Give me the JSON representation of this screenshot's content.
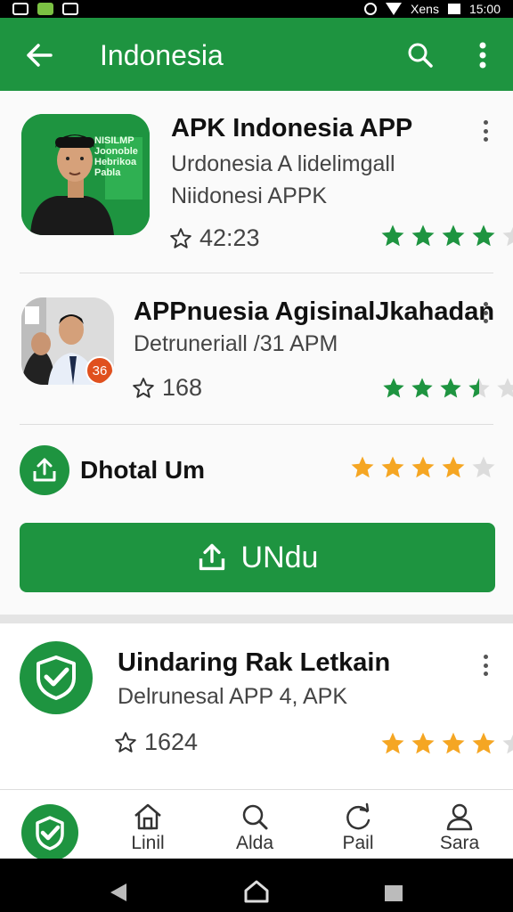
{
  "status_bar": {
    "time": "15:00",
    "carrier": "Xens"
  },
  "app_bar": {
    "title": "Indonesia",
    "back_icon": "arrow-left-icon",
    "search_icon": "search-icon",
    "more_icon": "more-vert-icon"
  },
  "apps": [
    {
      "name": "APK Indonesia APP",
      "subtitle": "Urdonesia A lidelimgall",
      "subtitle2": "Niidonesi APPK",
      "rating_count": "42:23",
      "icon_text": "NISILMP Joonoble Hebrikoa Pabla",
      "stars": 4
    },
    {
      "name": "APPnuesia AgisinalJkahadan",
      "subtitle": "Detruneriall  /31 APM",
      "rating_count": "168",
      "badge": "36",
      "stars": 3.5
    }
  ],
  "download": {
    "title": "Dhotal Um",
    "button_label": "UNdu",
    "stars": 4
  },
  "app3": {
    "name": "Uindaring Rak Letkain",
    "subtitle": "Delrunesal APP 4, APK",
    "rating_count": "1624",
    "stars": 4
  },
  "bottom_nav": [
    {
      "label": "Linil",
      "icon": "home-icon"
    },
    {
      "label": "Alda",
      "icon": "search-icon"
    },
    {
      "label": "Pail",
      "icon": "refresh-icon"
    },
    {
      "label": "Sara",
      "icon": "person-icon"
    }
  ],
  "colors": {
    "primary": "#1e9440",
    "star_green": "#1e9440",
    "star_gold": "#f5a623"
  }
}
